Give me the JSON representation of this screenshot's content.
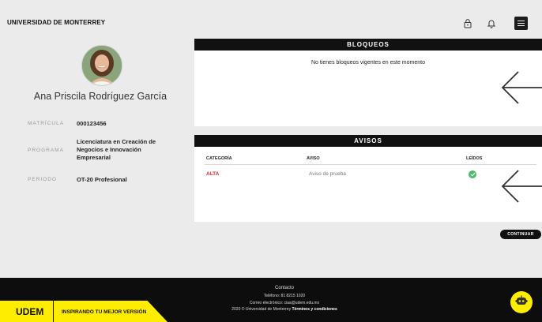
{
  "header": {
    "brand": "UNIVERSIDAD DE MONTERREY",
    "icons": [
      "lock-icon",
      "bell-icon",
      "menu-icon"
    ]
  },
  "profile": {
    "name": "Ana Priscila Rodríguez García",
    "fields": [
      {
        "label": "MATRÍCULA",
        "value": "000123456"
      },
      {
        "label": "PROGRAMA",
        "value_lines": [
          "Licenciatura en Creación de",
          "Negocios e Innovación",
          "Empresarial"
        ]
      },
      {
        "label": "PERIODO",
        "value": "OT-20 Profesional"
      }
    ]
  },
  "bloqueos": {
    "title": "BLOQUEOS",
    "message": "No tienes bloqueos vigentes en este momento"
  },
  "avisos": {
    "title": "AVISOS",
    "columns": [
      "CATEGORÍA",
      "AVISO",
      "LEÍDOS"
    ],
    "rows": [
      {
        "categoria": "ALTA",
        "aviso": "Aviso de prueba",
        "leido": true
      }
    ]
  },
  "continue_label": "CONTINUAR",
  "footer": {
    "contact": "Contacto",
    "phone": "Teléfono: 81 8215 1020",
    "email": "Correo electrónico: ciaa@udem.edu.mx",
    "copyright_prefix": "2020 © Universidad de Monterrey ",
    "terms": "Términos y condiciones",
    "logo": "UDEM",
    "tagline": "INSPIRANDO TU MEJOR VERSIÓN"
  },
  "colors": {
    "accent_yellow": "#ffed00",
    "alert_red": "#e0262d",
    "read_green": "#4cb96b",
    "dark": "#111111"
  }
}
